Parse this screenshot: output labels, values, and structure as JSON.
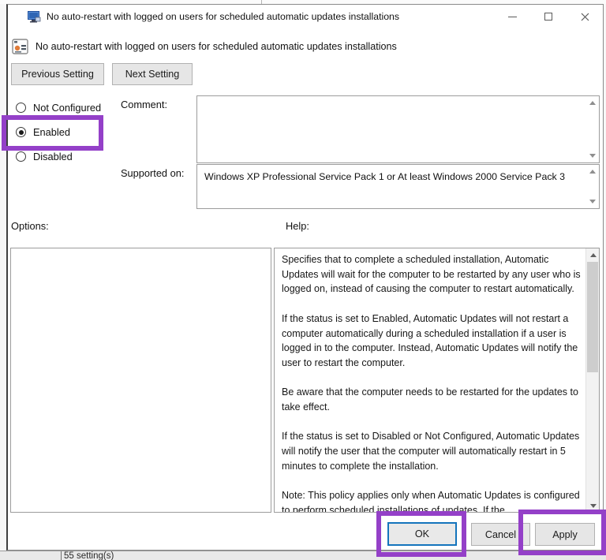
{
  "window": {
    "title": "No auto-restart with logged on users for scheduled automatic updates installations"
  },
  "header": {
    "title": "No auto-restart with logged on users for scheduled automatic updates installations",
    "previous_label": "Previous Setting",
    "next_label": "Next Setting"
  },
  "state": {
    "radios": [
      {
        "label": "Not Configured",
        "checked": false
      },
      {
        "label": "Enabled",
        "checked": true
      },
      {
        "label": "Disabled",
        "checked": false
      }
    ],
    "comment_label": "Comment:",
    "comment_value": "",
    "supported_label": "Supported on:",
    "supported_value": "Windows XP Professional Service Pack 1 or At least Windows 2000 Service Pack 3"
  },
  "options_panel": {
    "label": "Options:"
  },
  "help_panel": {
    "label": "Help:",
    "paragraphs": [
      "Specifies that to complete a scheduled installation, Automatic Updates will wait for the computer to be restarted by any user who is logged on, instead of causing the computer to restart automatically.",
      "If the status is set to Enabled, Automatic Updates will not restart a computer automatically during a scheduled installation if a user is logged in to the computer. Instead, Automatic Updates will notify the user to restart the computer.",
      "Be aware that the computer needs to be restarted for the updates to take effect.",
      "If the status is set to Disabled or Not Configured, Automatic Updates will notify the user that the computer will automatically restart in 5 minutes to complete the installation.",
      "Note: This policy applies only when Automatic Updates is configured to perform scheduled installations of updates. If the"
    ]
  },
  "footer": {
    "ok_label": "OK",
    "cancel_label": "Cancel",
    "apply_label": "Apply"
  },
  "background": {
    "status_text": "55 setting(s)"
  },
  "colors": {
    "annotation_purple": "#9440c8",
    "ok_focus_blue": "#1474bc",
    "button_gray": "#e6e6e6"
  }
}
